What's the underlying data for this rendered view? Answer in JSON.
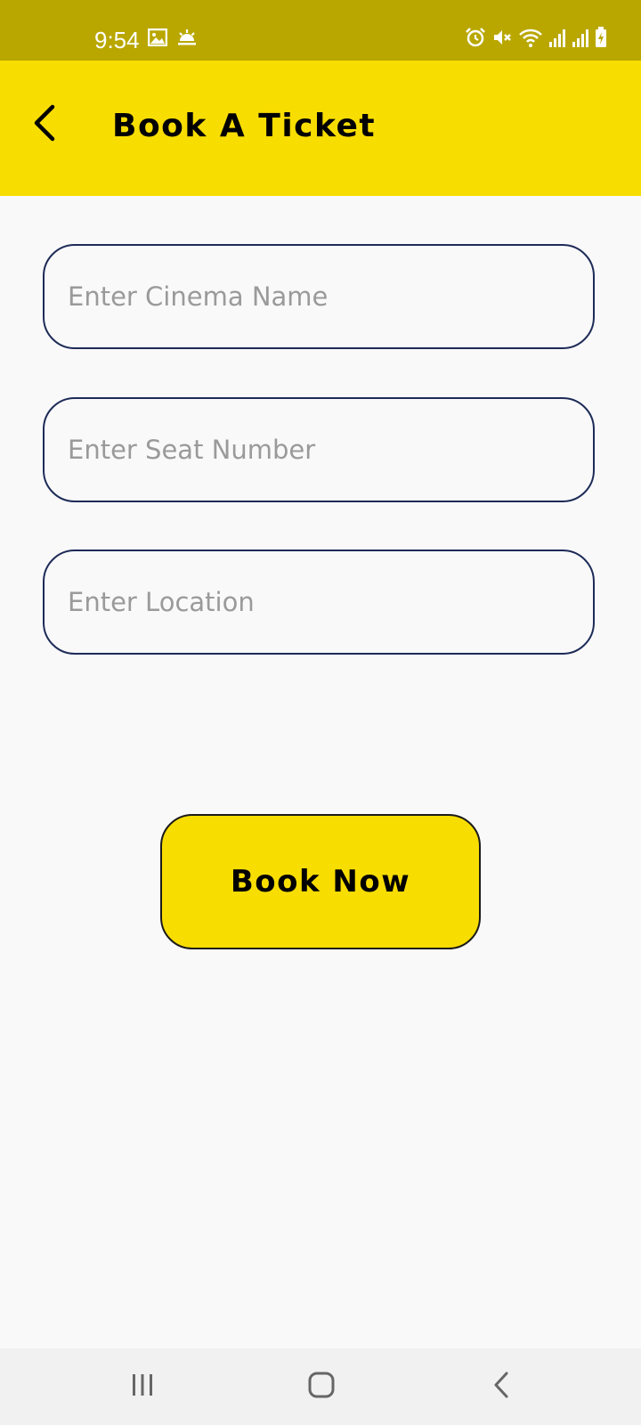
{
  "status_bar": {
    "time": "9:54",
    "left_icons": [
      "image-icon",
      "weather-icon"
    ],
    "right_icons": [
      "alarm-icon",
      "mute-icon",
      "wifi-icon",
      "signal-icon",
      "signal-icon",
      "battery-charging-icon"
    ]
  },
  "app_bar": {
    "title": "Book A Ticket",
    "back_icon": "chevron-left-icon",
    "background": "#f8dd00"
  },
  "form": {
    "cinema_name": {
      "placeholder": "Enter Cinema Name",
      "value": ""
    },
    "seat_number": {
      "placeholder": "Enter Seat Number",
      "value": ""
    },
    "location": {
      "placeholder": "Enter Location",
      "value": ""
    }
  },
  "book_button": {
    "label": "Book Now",
    "background": "#f8dd00"
  },
  "nav_bar": {
    "items": [
      "recents-icon",
      "home-icon",
      "back-icon"
    ]
  },
  "colors": {
    "status_bar": "#b9a700",
    "accent": "#f8dd00",
    "field_border": "#1d2b57",
    "background": "#f9f9fa"
  }
}
